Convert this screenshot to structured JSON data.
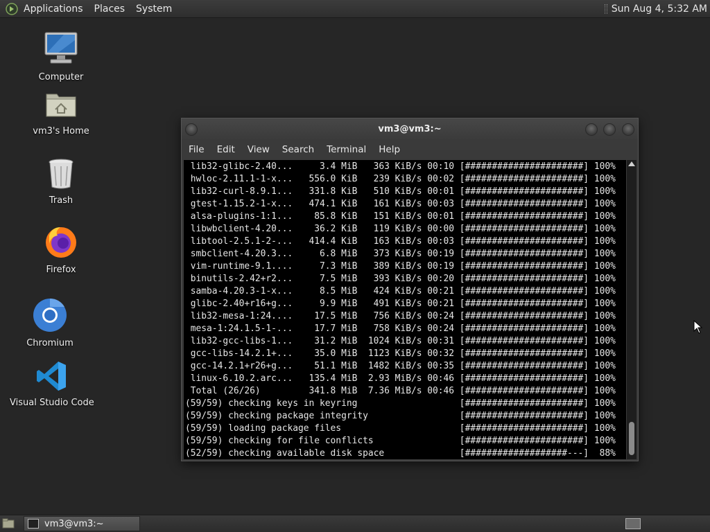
{
  "top_panel": {
    "menus": [
      "Applications",
      "Places",
      "System"
    ],
    "clock": "Sun Aug  4,  5:32 AM"
  },
  "desktop": {
    "icons": [
      "Computer",
      "vm3's Home",
      "Trash",
      "Firefox",
      "Chromium",
      "Visual Studio Code"
    ]
  },
  "terminal": {
    "title": "vm3@vm3:~",
    "menus": [
      "File",
      "Edit",
      "View",
      "Search",
      "Terminal",
      "Help"
    ],
    "lines": [
      " lib32-glibc-2.40...     3.4 MiB   363 KiB/s 00:10 [######################] 100%",
      " hwloc-2.11.1-1-x...   556.0 KiB   239 KiB/s 00:02 [######################] 100%",
      " lib32-curl-8.9.1...   331.8 KiB   510 KiB/s 00:01 [######################] 100%",
      " gtest-1.15.2-1-x...   474.1 KiB   161 KiB/s 00:03 [######################] 100%",
      " alsa-plugins-1:1...    85.8 KiB   151 KiB/s 00:01 [######################] 100%",
      " libwbclient-4.20...    36.2 KiB   119 KiB/s 00:00 [######################] 100%",
      " libtool-2.5.1-2-...   414.4 KiB   163 KiB/s 00:03 [######################] 100%",
      " smbclient-4.20.3...     6.8 MiB   373 KiB/s 00:19 [######################] 100%",
      " vim-runtime-9.1....     7.3 MiB   389 KiB/s 00:19 [######################] 100%",
      " binutils-2.42+r2...     7.5 MiB   393 KiB/s 00:20 [######################] 100%",
      " samba-4.20.3-1-x...     8.5 MiB   424 KiB/s 00:21 [######################] 100%",
      " glibc-2.40+r16+g...     9.9 MiB   491 KiB/s 00:21 [######################] 100%",
      " lib32-mesa-1:24....    17.5 MiB   756 KiB/s 00:24 [######################] 100%",
      " mesa-1:24.1.5-1-...    17.7 MiB   758 KiB/s 00:24 [######################] 100%",
      " lib32-gcc-libs-1...    31.2 MiB  1024 KiB/s 00:31 [######################] 100%",
      " gcc-libs-14.2.1+...    35.0 MiB  1123 KiB/s 00:32 [######################] 100%",
      " gcc-14.2.1+r26+g...    51.1 MiB  1482 KiB/s 00:35 [######################] 100%",
      " linux-6.10.2.arc...   135.4 MiB  2.93 MiB/s 00:46 [######################] 100%",
      " Total (26/26)         341.8 MiB  7.36 MiB/s 00:46 [######################] 100%",
      "(59/59) checking keys in keyring                   [######################] 100%",
      "(59/59) checking package integrity                 [######################] 100%",
      "(59/59) loading package files                      [######################] 100%",
      "(59/59) checking for file conflicts                [######################] 100%",
      "(52/59) checking available disk space              [###################---]  88%"
    ]
  },
  "taskbar": {
    "window_label": "vm3@vm3:~"
  }
}
